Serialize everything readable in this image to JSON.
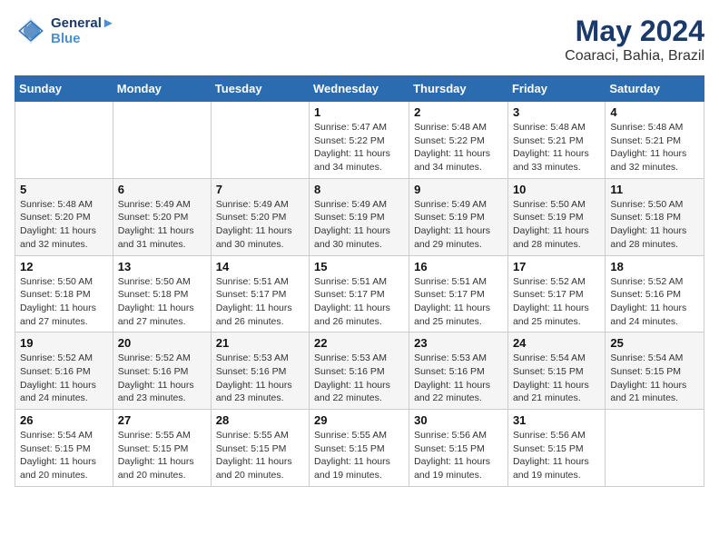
{
  "header": {
    "logo_line1": "General",
    "logo_line2": "Blue",
    "title": "May 2024",
    "subtitle": "Coaraci, Bahia, Brazil"
  },
  "weekdays": [
    "Sunday",
    "Monday",
    "Tuesday",
    "Wednesday",
    "Thursday",
    "Friday",
    "Saturday"
  ],
  "weeks": [
    [
      {
        "day": "",
        "info": ""
      },
      {
        "day": "",
        "info": ""
      },
      {
        "day": "",
        "info": ""
      },
      {
        "day": "1",
        "info": "Sunrise: 5:47 AM\nSunset: 5:22 PM\nDaylight: 11 hours and 34 minutes."
      },
      {
        "day": "2",
        "info": "Sunrise: 5:48 AM\nSunset: 5:22 PM\nDaylight: 11 hours and 34 minutes."
      },
      {
        "day": "3",
        "info": "Sunrise: 5:48 AM\nSunset: 5:21 PM\nDaylight: 11 hours and 33 minutes."
      },
      {
        "day": "4",
        "info": "Sunrise: 5:48 AM\nSunset: 5:21 PM\nDaylight: 11 hours and 32 minutes."
      }
    ],
    [
      {
        "day": "5",
        "info": "Sunrise: 5:48 AM\nSunset: 5:20 PM\nDaylight: 11 hours and 32 minutes."
      },
      {
        "day": "6",
        "info": "Sunrise: 5:49 AM\nSunset: 5:20 PM\nDaylight: 11 hours and 31 minutes."
      },
      {
        "day": "7",
        "info": "Sunrise: 5:49 AM\nSunset: 5:20 PM\nDaylight: 11 hours and 30 minutes."
      },
      {
        "day": "8",
        "info": "Sunrise: 5:49 AM\nSunset: 5:19 PM\nDaylight: 11 hours and 30 minutes."
      },
      {
        "day": "9",
        "info": "Sunrise: 5:49 AM\nSunset: 5:19 PM\nDaylight: 11 hours and 29 minutes."
      },
      {
        "day": "10",
        "info": "Sunrise: 5:50 AM\nSunset: 5:19 PM\nDaylight: 11 hours and 28 minutes."
      },
      {
        "day": "11",
        "info": "Sunrise: 5:50 AM\nSunset: 5:18 PM\nDaylight: 11 hours and 28 minutes."
      }
    ],
    [
      {
        "day": "12",
        "info": "Sunrise: 5:50 AM\nSunset: 5:18 PM\nDaylight: 11 hours and 27 minutes."
      },
      {
        "day": "13",
        "info": "Sunrise: 5:50 AM\nSunset: 5:18 PM\nDaylight: 11 hours and 27 minutes."
      },
      {
        "day": "14",
        "info": "Sunrise: 5:51 AM\nSunset: 5:17 PM\nDaylight: 11 hours and 26 minutes."
      },
      {
        "day": "15",
        "info": "Sunrise: 5:51 AM\nSunset: 5:17 PM\nDaylight: 11 hours and 26 minutes."
      },
      {
        "day": "16",
        "info": "Sunrise: 5:51 AM\nSunset: 5:17 PM\nDaylight: 11 hours and 25 minutes."
      },
      {
        "day": "17",
        "info": "Sunrise: 5:52 AM\nSunset: 5:17 PM\nDaylight: 11 hours and 25 minutes."
      },
      {
        "day": "18",
        "info": "Sunrise: 5:52 AM\nSunset: 5:16 PM\nDaylight: 11 hours and 24 minutes."
      }
    ],
    [
      {
        "day": "19",
        "info": "Sunrise: 5:52 AM\nSunset: 5:16 PM\nDaylight: 11 hours and 24 minutes."
      },
      {
        "day": "20",
        "info": "Sunrise: 5:52 AM\nSunset: 5:16 PM\nDaylight: 11 hours and 23 minutes."
      },
      {
        "day": "21",
        "info": "Sunrise: 5:53 AM\nSunset: 5:16 PM\nDaylight: 11 hours and 23 minutes."
      },
      {
        "day": "22",
        "info": "Sunrise: 5:53 AM\nSunset: 5:16 PM\nDaylight: 11 hours and 22 minutes."
      },
      {
        "day": "23",
        "info": "Sunrise: 5:53 AM\nSunset: 5:16 PM\nDaylight: 11 hours and 22 minutes."
      },
      {
        "day": "24",
        "info": "Sunrise: 5:54 AM\nSunset: 5:15 PM\nDaylight: 11 hours and 21 minutes."
      },
      {
        "day": "25",
        "info": "Sunrise: 5:54 AM\nSunset: 5:15 PM\nDaylight: 11 hours and 21 minutes."
      }
    ],
    [
      {
        "day": "26",
        "info": "Sunrise: 5:54 AM\nSunset: 5:15 PM\nDaylight: 11 hours and 20 minutes."
      },
      {
        "day": "27",
        "info": "Sunrise: 5:55 AM\nSunset: 5:15 PM\nDaylight: 11 hours and 20 minutes."
      },
      {
        "day": "28",
        "info": "Sunrise: 5:55 AM\nSunset: 5:15 PM\nDaylight: 11 hours and 20 minutes."
      },
      {
        "day": "29",
        "info": "Sunrise: 5:55 AM\nSunset: 5:15 PM\nDaylight: 11 hours and 19 minutes."
      },
      {
        "day": "30",
        "info": "Sunrise: 5:56 AM\nSunset: 5:15 PM\nDaylight: 11 hours and 19 minutes."
      },
      {
        "day": "31",
        "info": "Sunrise: 5:56 AM\nSunset: 5:15 PM\nDaylight: 11 hours and 19 minutes."
      },
      {
        "day": "",
        "info": ""
      }
    ]
  ]
}
